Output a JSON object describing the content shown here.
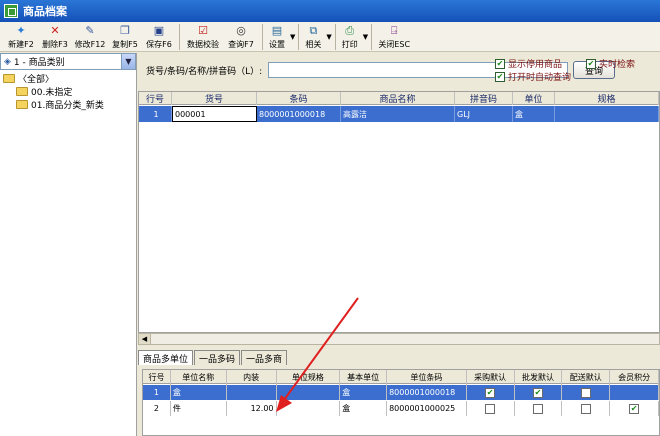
{
  "window": {
    "title": "商品档案"
  },
  "toolbar": {
    "new": "新建F2",
    "delete": "删除F3",
    "modify": "修改F12",
    "copy": "复制F5",
    "save": "保存F6",
    "verify": "数据校验",
    "search": "查询F7",
    "settings": "设置",
    "related": "相关",
    "print": "打印",
    "close": "关闭ESC"
  },
  "left_panel": {
    "category_select": "1 - 商品类别",
    "tree": [
      "〈全部〉",
      "00.未指定",
      "01.商品分类_新类"
    ]
  },
  "search": {
    "label": "货号/条码/名称/拼音码（L）:",
    "value": "",
    "button": "查询",
    "opt_show_disabled": "显示停用商品",
    "opt_realtime": "实时检索",
    "opt_auto_query": "打开时自动查询"
  },
  "grid": {
    "headers": [
      "行号",
      "货号",
      "条码",
      "商品名称",
      "拼音码",
      "单位",
      "规格"
    ],
    "rows": [
      [
        "1",
        "000001",
        "8000001000018",
        "高露洁",
        "GLJ",
        "盒",
        ""
      ]
    ]
  },
  "tabs": [
    "商品多单位",
    "一品多码",
    "一品多商"
  ],
  "units_grid": {
    "headers": [
      "行号",
      "单位名称",
      "内装",
      "单位规格",
      "基本单位",
      "单位条码",
      "采购默认",
      "批发默认",
      "配送默认",
      "会员积分"
    ],
    "rows": [
      {
        "no": "1",
        "name": "盒",
        "pack": "",
        "spec": "",
        "base": "盒",
        "barcode": "8000001000018",
        "purchase": true,
        "wholesale": true,
        "delivery": false,
        "points": false
      },
      {
        "no": "2",
        "name": "件",
        "pack": "12.00",
        "spec": "",
        "base": "盒",
        "barcode": "8000001000025",
        "purchase": false,
        "wholesale": false,
        "delivery": false,
        "points": true
      }
    ]
  },
  "colors": {
    "title": "#1551b8",
    "selection": "#3c6ed0",
    "annotation": "#e02020"
  }
}
